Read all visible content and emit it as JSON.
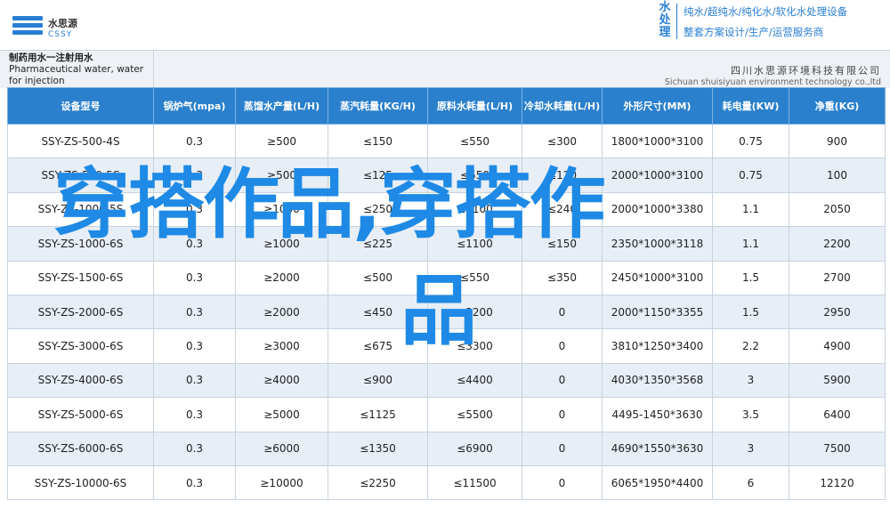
{
  "brand": {
    "logo_cn": "水思源",
    "logo_en": "CSSY",
    "vertical": "水处理",
    "line1": "纯水/超纯水/纯化水/软化水处理设备",
    "line2": "整套方案设计/生产/运营服务商"
  },
  "product": {
    "title_cn": "制药用水一注射用水",
    "title_en": "Pharmaceutical water, water for injection"
  },
  "company": {
    "name_cn": "四川水思源环境科技有限公司",
    "name_en": "Sichuan shuisiyuan environment technology co.,ltd"
  },
  "table": {
    "headers": [
      "设备型号",
      "锅炉气(mpa)",
      "蒸馏水产量(L/H)",
      "蒸汽耗量(KG/H)",
      "原料水耗量(L/H)",
      "冷却水耗量(L/H)",
      "外形尺寸(MM)",
      "耗电量(KW)",
      "净重(KG)"
    ],
    "rows": [
      [
        "SSY-ZS-500-4S",
        "0.3",
        "≥500",
        "≤150",
        "≤550",
        "≤300",
        "1800*1000*3100",
        "0.75",
        "900"
      ],
      [
        "SSY-ZS-500-5S",
        "0.3",
        "≥500",
        "≤125",
        "≤550",
        "≤120",
        "2000*1000*3100",
        "0.75",
        "100"
      ],
      [
        "SSY-ZS-1000-5S",
        "0.3",
        "≥1000",
        "≤250",
        "≤1100",
        "≤240",
        "2000*1000*3380",
        "1.1",
        "2050"
      ],
      [
        "SSY-ZS-1000-6S",
        "0.3",
        "≥1000",
        "≤225",
        "≤1100",
        "≤150",
        "2350*1000*3118",
        "1.1",
        "2200"
      ],
      [
        "SSY-ZS-1500-6S",
        "0.3",
        "≥2000",
        "≤500",
        "≤550",
        "≤350",
        "2450*1000*3100",
        "1.5",
        "2700"
      ],
      [
        "SSY-ZS-2000-6S",
        "0.3",
        "≥2000",
        "≤450",
        "≤2200",
        "0",
        "2000*1150*3355",
        "1.5",
        "2950"
      ],
      [
        "SSY-ZS-3000-6S",
        "0.3",
        "≥3000",
        "≤675",
        "≤3300",
        "0",
        "3810*1250*3400",
        "2.2",
        "4900"
      ],
      [
        "SSY-ZS-4000-6S",
        "0.3",
        "≥4000",
        "≤900",
        "≤4400",
        "0",
        "4030*1350*3568",
        "3",
        "5900"
      ],
      [
        "SSY-ZS-5000-6S",
        "0.3",
        "≥5000",
        "≤1125",
        "≤5500",
        "0",
        "4495-1450*3630",
        "3.5",
        "6400"
      ],
      [
        "SSY-ZS-6000-6S",
        "0.3",
        "≥6000",
        "≤1350",
        "≤6900",
        "0",
        "4690*1550*3630",
        "3",
        "7500"
      ],
      [
        "SSY-ZS-10000-6S",
        "0.3",
        "≥10000",
        "≤2250",
        "≤11500",
        "0",
        "6065*1950*4400",
        "6",
        "12120"
      ]
    ]
  },
  "overlay": {
    "line1": "穿搭作品,穿搭作",
    "line2": "品"
  },
  "colors": {
    "header_blue": "#2a80cc",
    "overlay_blue": "#1e8ae6",
    "row_alt": "#e7eef6"
  }
}
